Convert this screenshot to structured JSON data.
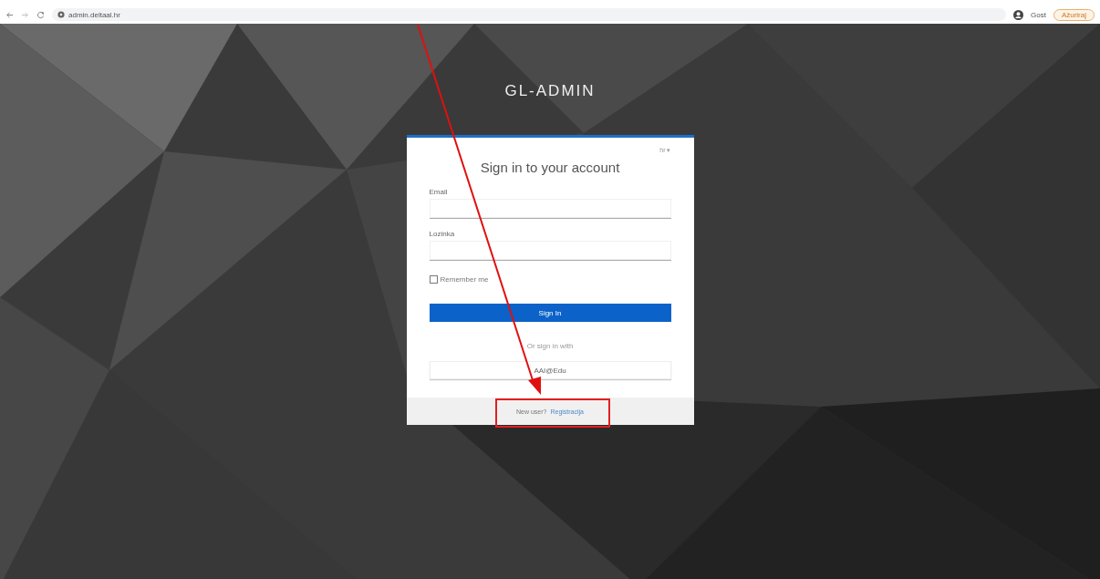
{
  "browser": {
    "url": "admin.deltaal.hr",
    "profile": "Gost",
    "update_button": "Ažuriraj"
  },
  "app_title": "GL-ADMIN",
  "login": {
    "language": "hr ▾",
    "heading": "Sign in to your account",
    "fields": [
      {
        "label": "Email"
      },
      {
        "label": "Lozinka"
      }
    ],
    "remember": {
      "label": "Remember me",
      "checked": false
    },
    "submit": "Sign In",
    "alt_heading": "Or sign in with",
    "alt_provider": "AAI@Edu",
    "footer": {
      "question": "New user?",
      "link": "Registracija"
    }
  }
}
